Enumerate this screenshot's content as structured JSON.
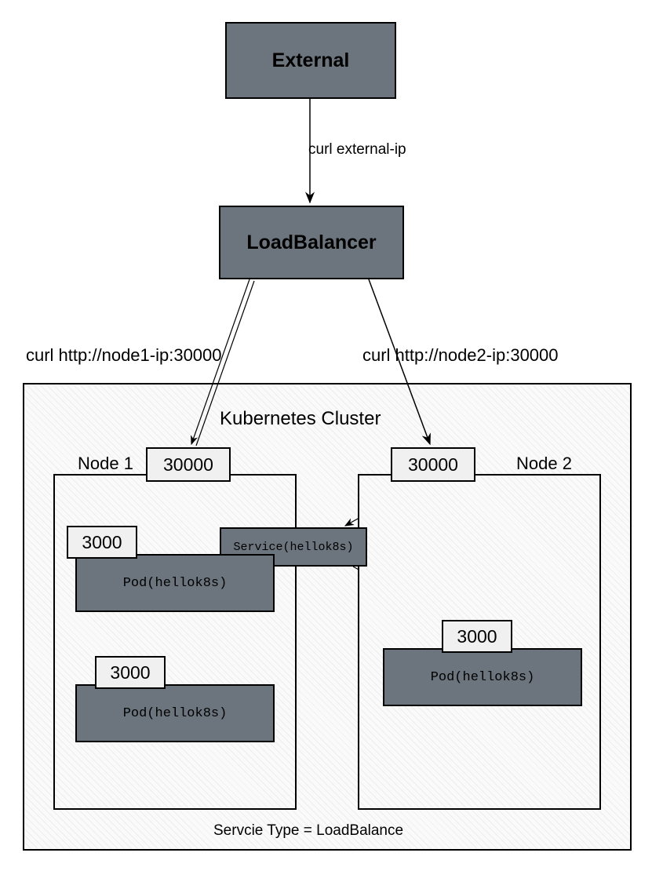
{
  "external": {
    "label": "External"
  },
  "curl_external": "curl external-ip",
  "loadbalancer": {
    "label": "LoadBalancer"
  },
  "curl_node1": "curl http://node1-ip:30000",
  "curl_node2": "curl http://node2-ip:30000",
  "cluster": {
    "title": "Kubernetes Cluster"
  },
  "node1": {
    "label": "Node 1",
    "nodeport": "30000",
    "pods": [
      {
        "label": "Pod(hellok8s)",
        "port": "3000"
      },
      {
        "label": "Pod(hellok8s)",
        "port": "3000"
      }
    ]
  },
  "node2": {
    "label": "Node 2",
    "nodeport": "30000",
    "pods": [
      {
        "label": "Pod(hellok8s)",
        "port": "3000"
      }
    ]
  },
  "service": {
    "label": "Service(hellok8s)"
  },
  "footer": "Servcie Type = LoadBalance"
}
